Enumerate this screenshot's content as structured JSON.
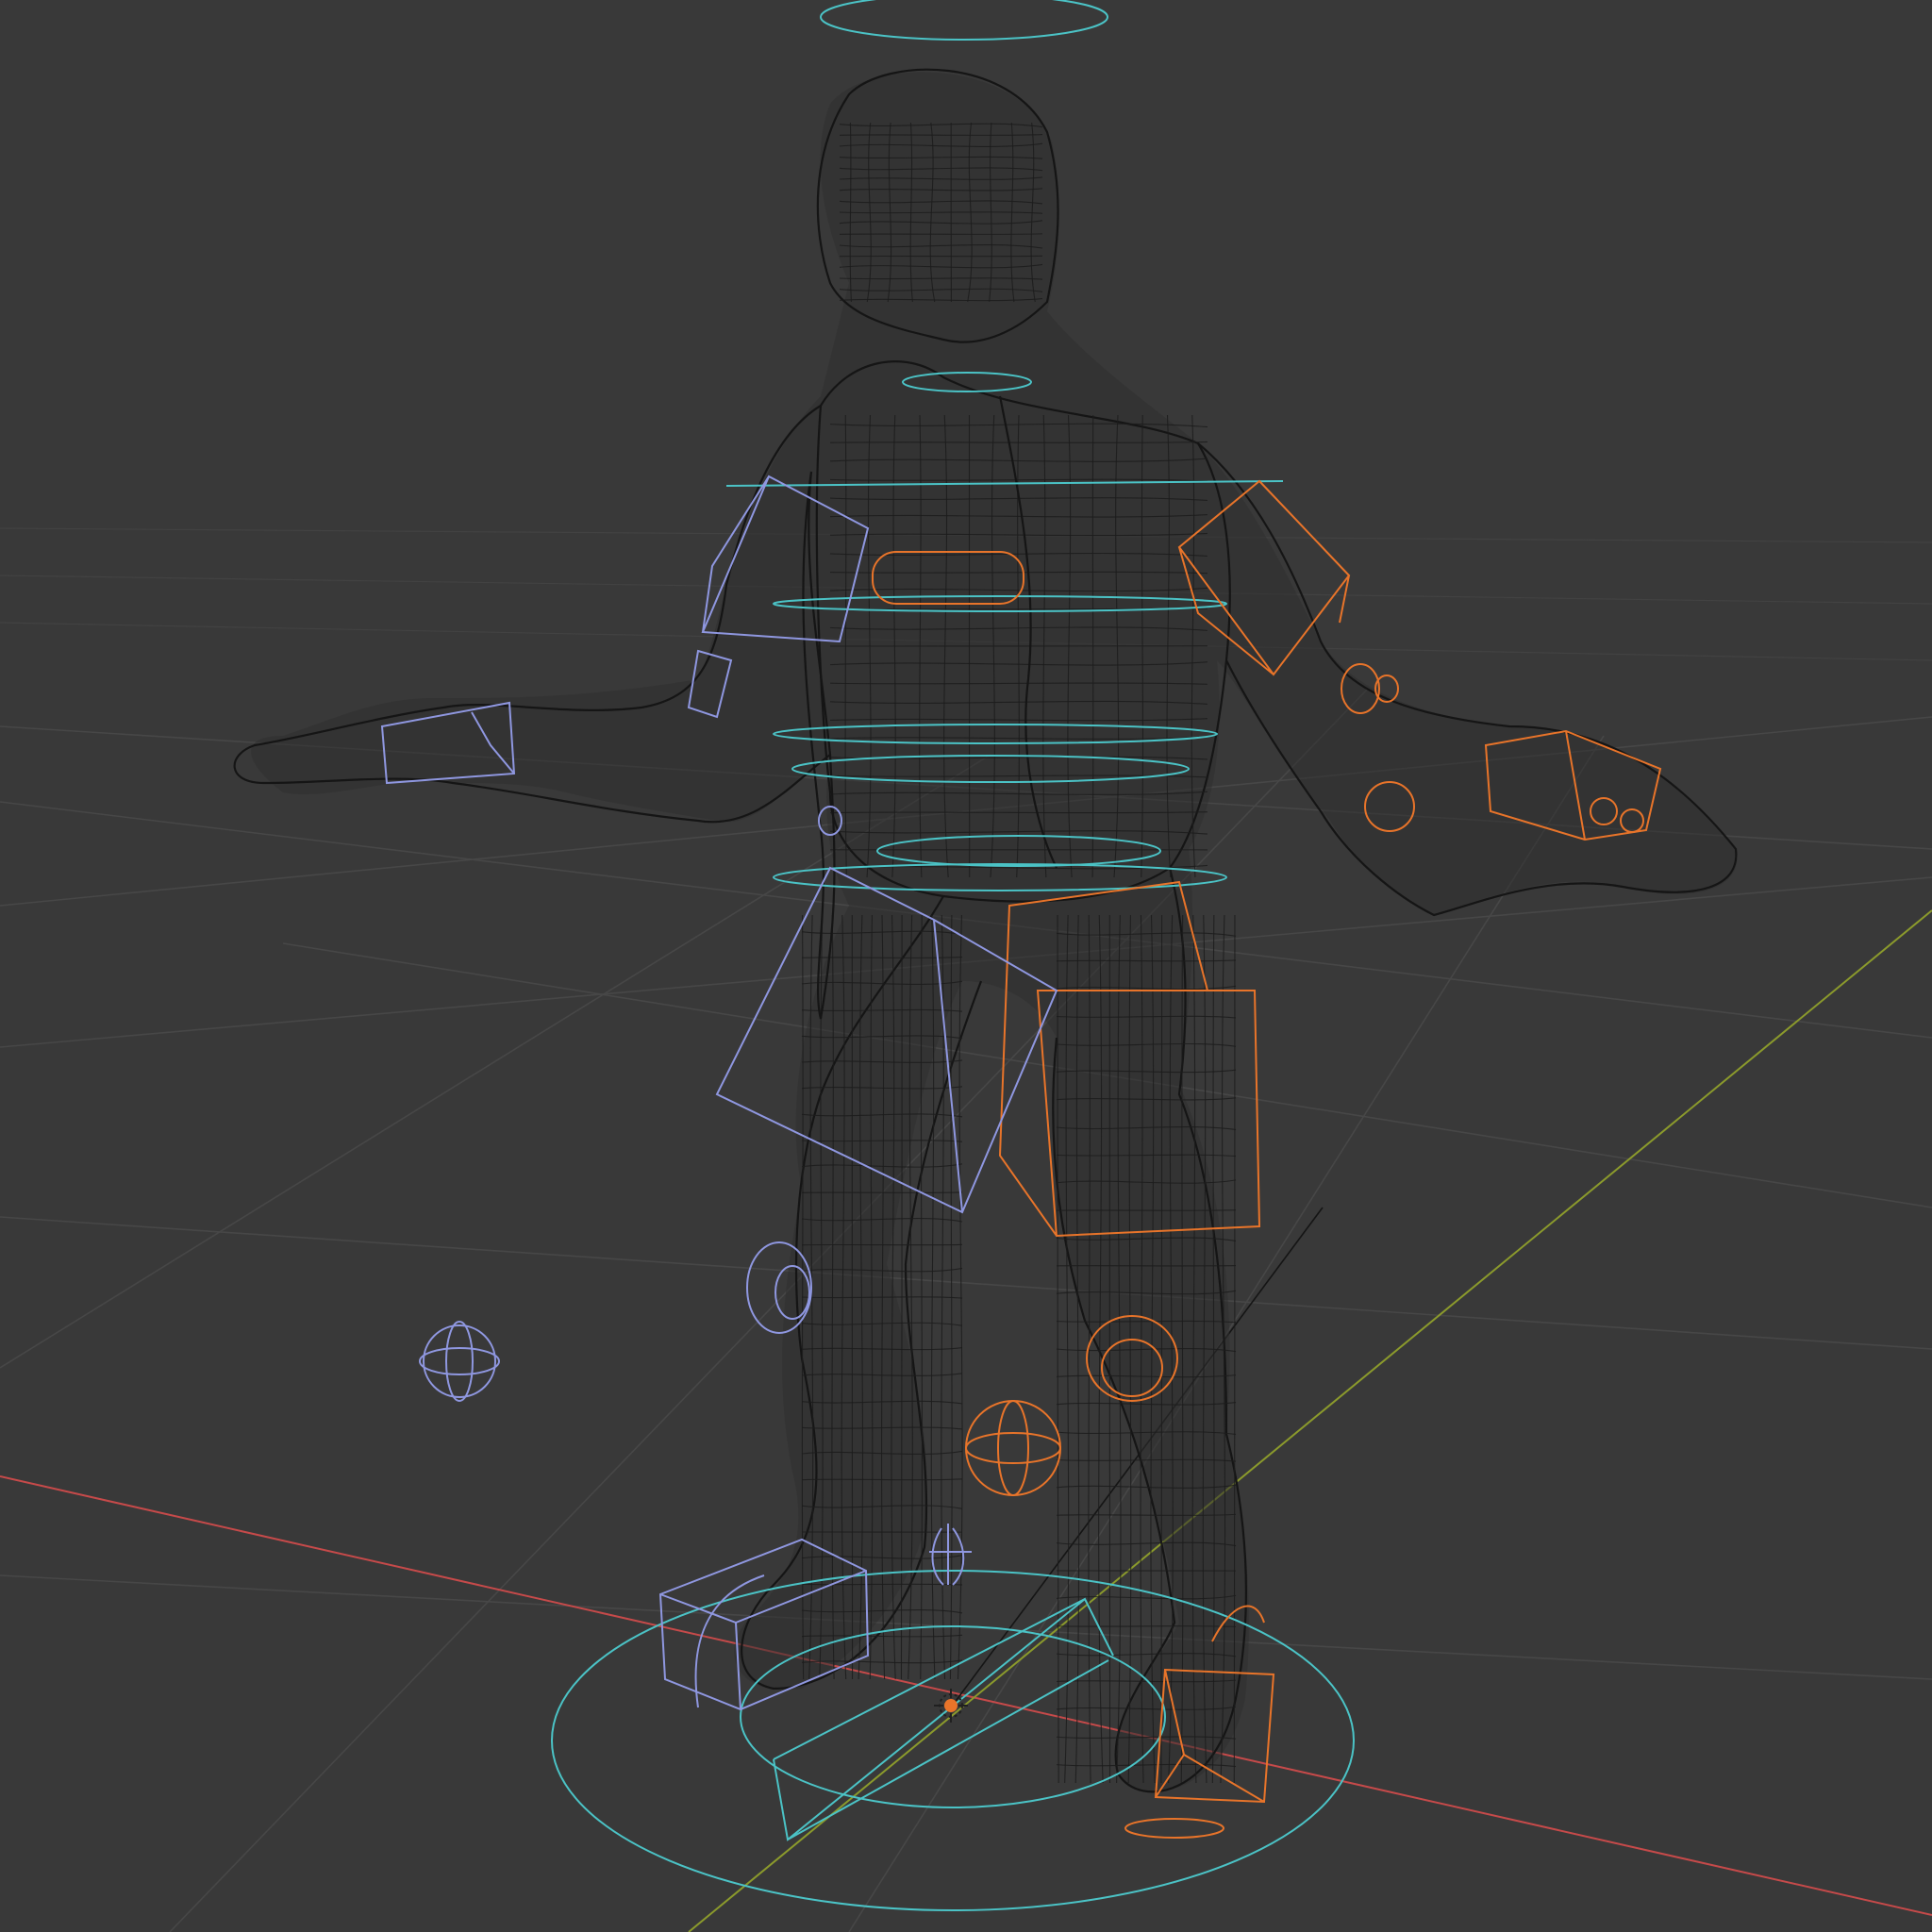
{
  "viewport": {
    "mode": "wireframe",
    "background": "#393939",
    "grid_color": "#474747"
  },
  "axes": {
    "x_axis_color": "#c64a4a",
    "y_axis_color": "#8b9a2c",
    "z_axis_color": "#151515"
  },
  "rig": {
    "selected_bone_color": "#e8742a",
    "left_bone_color": "#8f97e0",
    "control_color": "#4bc3c6",
    "mesh_color": "#1c1c1c"
  },
  "origin_icon": "3d-cursor-icon"
}
